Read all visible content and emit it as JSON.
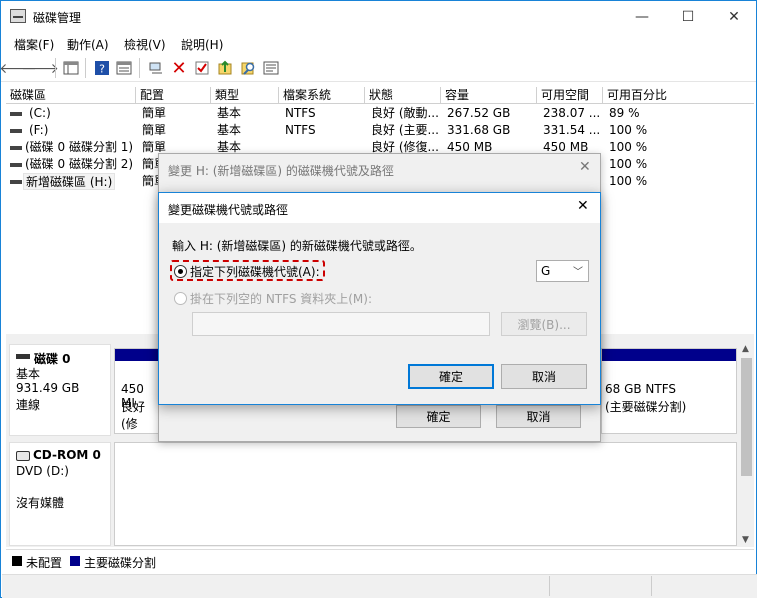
{
  "window": {
    "title": "磁碟管理",
    "minimize": "—",
    "maximize": "☐",
    "close": "✕"
  },
  "menu": [
    "檔案(F)",
    "動作(A)",
    "檢視(V)",
    "說明(H)"
  ],
  "toolbar_icons": [
    "back-icon",
    "forward-icon",
    "console-tree-icon",
    "help-icon",
    "view-icon",
    "connect-icon",
    "delete-icon",
    "properties-icon",
    "import-icon",
    "search-icon",
    "settings-icon"
  ],
  "volume_table": {
    "columns": [
      "磁碟區",
      "配置",
      "類型",
      "檔案系統",
      "狀態",
      "容量",
      "可用空間",
      "可用百分比"
    ],
    "rows": [
      [
        "(C:)",
        "簡單",
        "基本",
        "NTFS",
        "良好 (敵動...",
        "267.52 GB",
        "238.07 ...",
        "89 %"
      ],
      [
        "(F:)",
        "簡單",
        "基本",
        "NTFS",
        "良好 (主要...",
        "331.68 GB",
        "331.54 ...",
        "100 %"
      ],
      [
        "(磁碟 0 磁碟分割 1)",
        "簡單",
        "基本",
        "",
        "良好 (修復...",
        "450 MB",
        "450 MB",
        "100 %"
      ],
      [
        "(磁碟 0 磁碟分割 2)",
        "簡單",
        "",
        "",
        "",
        "",
        "",
        "100 %"
      ],
      [
        "新增磁碟區 (H:)",
        "簡單",
        "",
        "",
        "",
        "",
        "",
        "100 %"
      ]
    ]
  },
  "disks": {
    "disk0": {
      "name": "磁碟 0",
      "type": "基本",
      "size": "931.49 GB",
      "status": "連線",
      "part1_size": "450 MI",
      "part1_status": "良好 (修",
      "part_right_size": "68 GB NTFS",
      "part_right_status": "(主要磁碟分割)"
    },
    "cdrom": {
      "name": "CD-ROM 0",
      "drive": "DVD (D:)",
      "media": "沒有媒體"
    }
  },
  "legend": {
    "unallocated": "未配置",
    "primary": "主要磁碟分割"
  },
  "colors": {
    "unallocated": "#000000",
    "primary": "#00008b",
    "accent": "#0078d7",
    "highlight": "#cc0000"
  },
  "dialog_back": {
    "title": "變更 H: (新增磁碟區) 的磁碟機代號及路徑",
    "ok": "確定",
    "cancel": "取消"
  },
  "dialog": {
    "title": "變更磁碟機代號或路徑",
    "prompt": "輸入 H: (新增磁碟區) 的新磁碟機代號或路徑。",
    "option_letter": "指定下列磁碟機代號(A):",
    "selected_letter": "G",
    "option_path": "掛在下列空的 NTFS 資料夾上(M):",
    "browse": "瀏覽(B)...",
    "ok": "確定",
    "cancel": "取消"
  }
}
